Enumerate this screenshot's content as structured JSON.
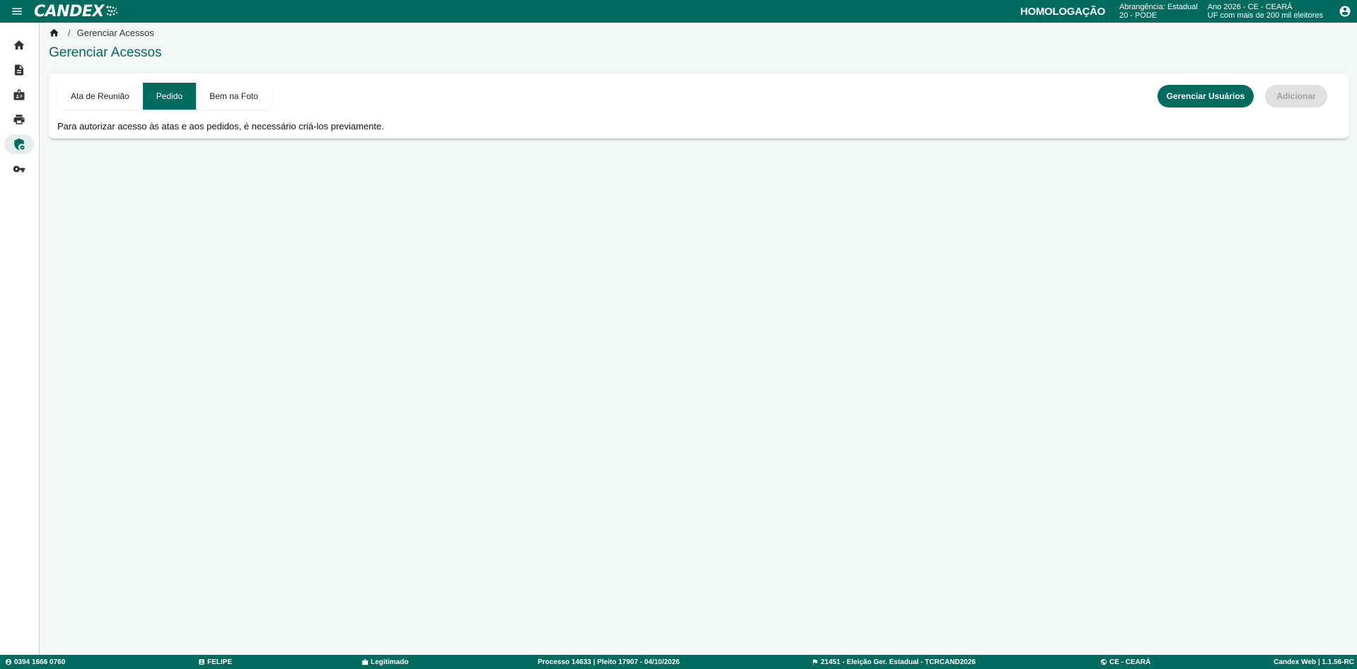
{
  "header": {
    "logo_text": "CANDEX",
    "environment": "HOMOLOGAÇÃO",
    "scope_line1": "Abrangência: Estadual",
    "scope_line2": "20 - PODE",
    "year_line1": "Ano 2026 - CE - CEARÁ",
    "year_line2": "UF com mais de 200 mil eleitores"
  },
  "sidebar": {
    "items": [
      {
        "icon": "home-icon"
      },
      {
        "icon": "document-icon"
      },
      {
        "icon": "badge-icon"
      },
      {
        "icon": "print-icon"
      },
      {
        "icon": "security-icon",
        "active": true
      },
      {
        "icon": "key-icon"
      }
    ]
  },
  "breadcrumb": {
    "current": "Gerenciar Acessos"
  },
  "page": {
    "title": "Gerenciar Acessos",
    "tabs": [
      {
        "label": "Ata de Reunião",
        "active": false
      },
      {
        "label": "Pedido",
        "active": true
      },
      {
        "label": "Bem na Foto",
        "active": false
      }
    ],
    "manage_users_label": "Gerenciar Usuários",
    "add_label": "Adicionar",
    "message": "Para autorizar acesso às atas e aos pedidos, é necessário criá-los previamente."
  },
  "footer": {
    "phone": "0394 1666 0760",
    "user": "FELIPE",
    "status": "Legitimado",
    "process": "Processo 14633 | Pleito 17907 - 04/10/2026",
    "election": "21451 - Eleição Ger. Estadual - TCRCAND2026",
    "state": "CE - CEARÁ",
    "version": "Candex Web | 1.1.56-RC"
  },
  "colors": {
    "brand": "#006b5f",
    "background": "#f3f7f6",
    "disabled": "#e0e0e0"
  }
}
